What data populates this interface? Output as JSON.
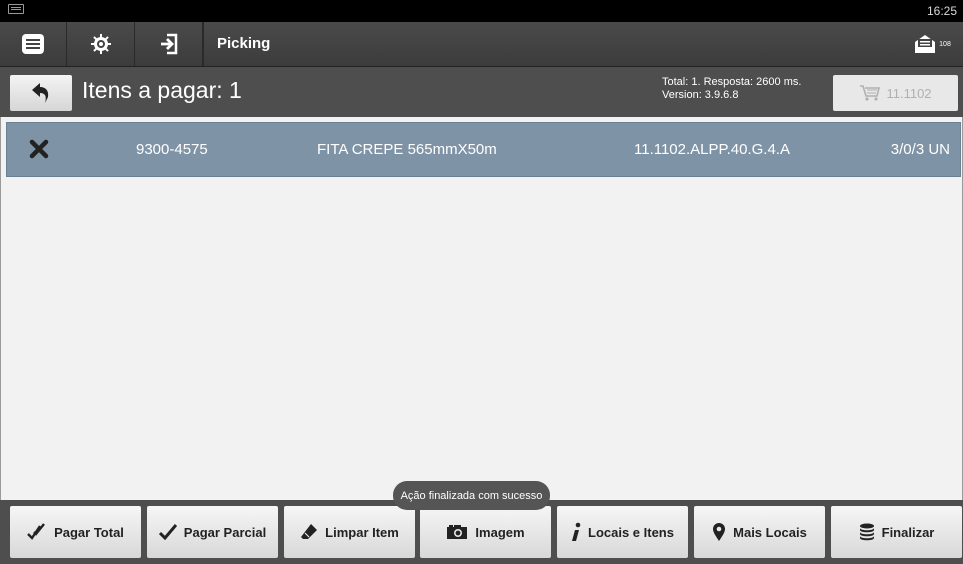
{
  "statusbar": {
    "time": "16:25"
  },
  "actionbar": {
    "title": "Picking",
    "mail_count": "108",
    "icons": [
      "menu-icon",
      "gear-icon",
      "login-icon",
      "mail-icon"
    ]
  },
  "header": {
    "title": "Itens a pagar: 1",
    "info_line1": "Total: 1. Resposta: 2600 ms.",
    "info_line2": "Version: 3.9.6.8",
    "cart_label": "11.1102"
  },
  "items": [
    {
      "code": "9300-4575",
      "description": "FITA CREPE 565mmX50m",
      "location": "11.1102.ALPP.40.G.4.A",
      "quantity": "3/0/3 UN"
    }
  ],
  "toast": "Ação finalizada com sucesso",
  "bottom": {
    "pagar_total": "Pagar Total",
    "pagar_parcial": "Pagar Parcial",
    "limpar_item": "Limpar Item",
    "imagem": "Imagem",
    "locais_itens": "Locais e Itens",
    "mais_locais": "Mais Locais",
    "finalizar": "Finalizar"
  },
  "colors": {
    "row_selected": "#7f93a6",
    "bar_dark": "#4e4e4e",
    "action_bar": "#3c3c3c"
  }
}
